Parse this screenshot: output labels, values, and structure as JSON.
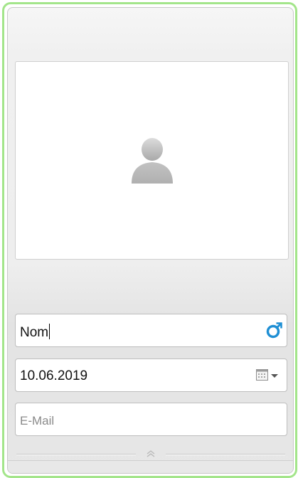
{
  "contact_card": {
    "photo": {
      "icon": "user-silhouette-icon"
    },
    "name_field": {
      "value": "Nom",
      "icon": "male-gender-icon",
      "icon_color": "#1f8fd4"
    },
    "date_field": {
      "value": "10.06.2019",
      "icon": "calendar-dropdown-icon"
    },
    "email_field": {
      "placeholder": "E-Mail"
    },
    "splitter": {
      "icon": "chevron-up-double-icon"
    }
  },
  "colors": {
    "frame_border": "#a3e58a",
    "panel_background": "#eeeeee"
  }
}
